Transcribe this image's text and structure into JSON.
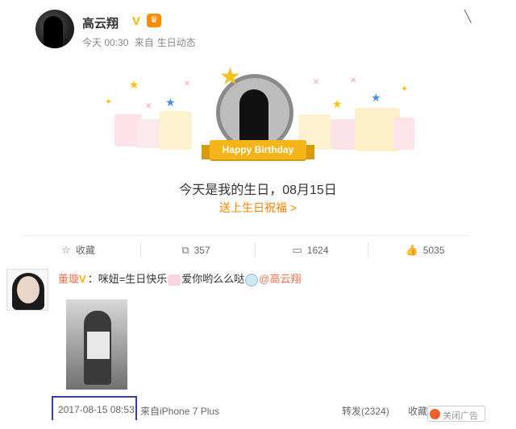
{
  "post": {
    "author": "高云翔",
    "verified_mark": "V",
    "time": "今天 00:30",
    "source_prefix": "来自",
    "source": "生日动态"
  },
  "birthday_card": {
    "ribbon": "Happy Birthday",
    "message": "今天是我的生日，08月15日",
    "send_wishes": "送上生日祝福 >"
  },
  "actions": [
    {
      "label": "收藏",
      "icon": "star-outline-icon"
    },
    {
      "label": "357",
      "icon": "repost-icon"
    },
    {
      "label": "1624",
      "icon": "comment-icon"
    },
    {
      "label": "5035",
      "icon": "like-icon"
    }
  ],
  "comment": {
    "commenter": "董璇",
    "badge": "V",
    "text_part1": "：咪妞=生日快乐",
    "text_part2": "爱你哟么么哒",
    "mention": "@高云翔",
    "timestamp": "2017-08-15 08:53",
    "source": "来自iPhone 7 Plus",
    "repost": "转发(2324)",
    "collect": "收藏",
    "overlay_text": "关闭广告"
  },
  "colors": {
    "orange_link": "#ff8200",
    "name_link": "#eb7350",
    "ribbon": "#f3b51a",
    "highlight_box": "#3a3f9e"
  }
}
